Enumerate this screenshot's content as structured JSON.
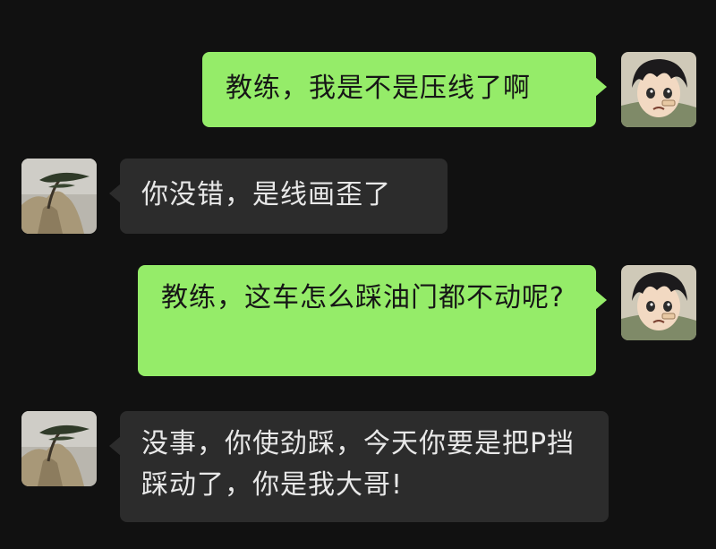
{
  "conversation": {
    "messages": [
      {
        "sender": "self",
        "avatar": "anime-boy-avatar",
        "text": "教练，我是不是压线了啊"
      },
      {
        "sender": "other",
        "avatar": "pine-tree-cliff-avatar",
        "text": "你没错，是线画歪了"
      },
      {
        "sender": "self",
        "avatar": "anime-boy-avatar",
        "text": "教练，这车怎么踩油门都不动呢?"
      },
      {
        "sender": "other",
        "avatar": "pine-tree-cliff-avatar",
        "text": "没事，你使劲踩，今天你要是把P挡踩动了，你是我大哥!"
      }
    ]
  },
  "colors": {
    "background": "#111111",
    "self_bubble": "#95ec69",
    "other_bubble": "#2c2c2c",
    "self_text": "#161616",
    "other_text": "#e8e8e8"
  }
}
